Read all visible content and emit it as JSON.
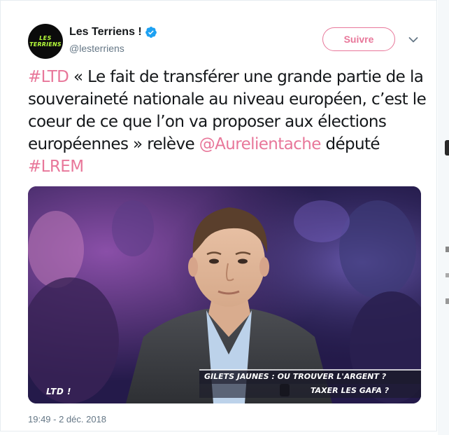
{
  "tweet": {
    "author": {
      "display_name": "Les Terriens !",
      "username": "@lesterriens",
      "avatar_text_line1": "LES",
      "avatar_text_line2": "TERRIENS",
      "verified": true
    },
    "follow_label": "Suivre",
    "text": {
      "hashtag_ltd": "#LTD",
      "body": " « Le fait de transférer une grande partie de la souveraineté nationale au niveau européen, c’est le coeur de ce que l’on va proposer aux élections européennes » relève ",
      "mention": "@Aurelientache",
      "middle": " député ",
      "hashtag_lrem": "#LREM"
    },
    "media": {
      "overlay_logo": "LTD !",
      "banner_line1": "GILETS JAUNES : OU TROUVER L'ARGENT ?",
      "banner_line2": "TAXER LES GAFA ?"
    },
    "timestamp": "19:49 - 2 déc. 2018"
  },
  "colors": {
    "accent": "#e8779a",
    "text": "#14171a",
    "secondary": "#657786",
    "verified": "#1da1f2",
    "avatar_logo": "#b7ff3b"
  },
  "icons": {
    "verified": "verified-badge-icon",
    "caret": "chevron-down-icon"
  }
}
